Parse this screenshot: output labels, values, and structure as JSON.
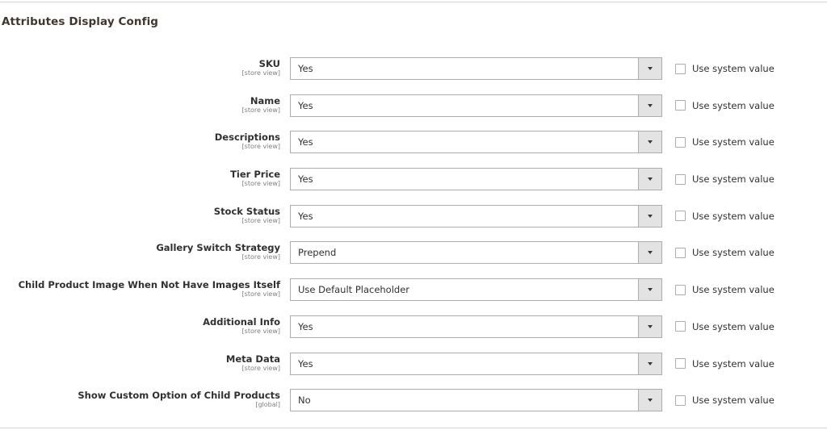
{
  "section": {
    "title": "Attributes Display Config"
  },
  "fields": [
    {
      "label": "SKU",
      "scope": "[store view]",
      "value": "Yes",
      "use_system_label": "Use system value",
      "use_system_checked": false
    },
    {
      "label": "Name",
      "scope": "[store view]",
      "value": "Yes",
      "use_system_label": "Use system value",
      "use_system_checked": false
    },
    {
      "label": "Descriptions",
      "scope": "[store view]",
      "value": "Yes",
      "use_system_label": "Use system value",
      "use_system_checked": false
    },
    {
      "label": "Tier Price",
      "scope": "[store view]",
      "value": "Yes",
      "use_system_label": "Use system value",
      "use_system_checked": false
    },
    {
      "label": "Stock Status",
      "scope": "[store view]",
      "value": "Yes",
      "use_system_label": "Use system value",
      "use_system_checked": false
    },
    {
      "label": "Gallery Switch Strategy",
      "scope": "[store view]",
      "value": "Prepend",
      "use_system_label": "Use system value",
      "use_system_checked": false
    },
    {
      "label": "Child Product Image When Not Have Images Itself",
      "scope": "[store view]",
      "value": "Use Default Placeholder",
      "use_system_label": "Use system value",
      "use_system_checked": false
    },
    {
      "label": "Additional Info",
      "scope": "[store view]",
      "value": "Yes",
      "use_system_label": "Use system value",
      "use_system_checked": false
    },
    {
      "label": "Meta Data",
      "scope": "[store view]",
      "value": "Yes",
      "use_system_label": "Use system value",
      "use_system_checked": false
    },
    {
      "label": "Show Custom Option of Child Products",
      "scope": "[global]",
      "value": "No",
      "use_system_label": "Use system value",
      "use_system_checked": false
    }
  ],
  "icons": {
    "dropdown": "chevron-down-icon",
    "checkbox": "checkbox-unchecked-icon"
  }
}
